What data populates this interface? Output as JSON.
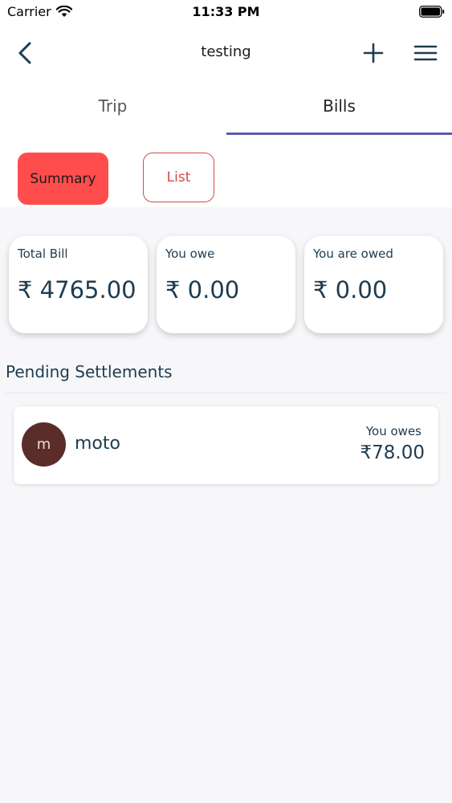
{
  "status_bar": {
    "carrier": "Carrier",
    "time": "11:33 PM"
  },
  "header": {
    "title": "testing"
  },
  "tabs": [
    {
      "label": "Trip"
    },
    {
      "label": "Bills"
    }
  ],
  "segments": {
    "summary": "Summary",
    "list": "List"
  },
  "cards": [
    {
      "label": "Total Bill",
      "amount": "₹ 4765.00"
    },
    {
      "label": "You owe",
      "amount": "₹ 0.00"
    },
    {
      "label": "You are owed",
      "amount": "₹ 0.00"
    }
  ],
  "pending": {
    "title": "Pending Settlements",
    "items": [
      {
        "initial": "m",
        "name": "moto",
        "owe_label": "You owes",
        "amount": "₹78.00"
      }
    ]
  },
  "colors": {
    "accent": "#ff4d4d",
    "tab_indicator": "#5b5bb0",
    "text": "#1d3c50",
    "avatar": "#5b2d2a"
  },
  "icons": {
    "back": "chevron-left-icon",
    "add": "plus-icon",
    "menu": "hamburger-icon"
  }
}
